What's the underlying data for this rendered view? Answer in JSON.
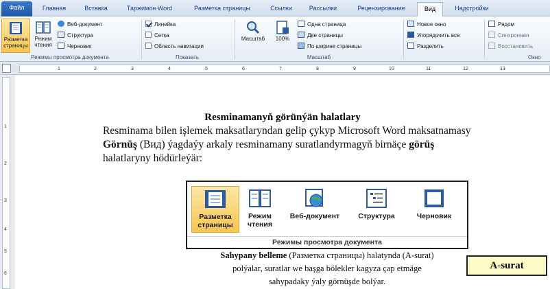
{
  "tabs": [
    "Файл",
    "Главная",
    "Вставка",
    "Таржимон Word",
    "Разметка страницы",
    "Ссылки",
    "Рассылки",
    "Рецензирование",
    "Вид",
    "Надстройки"
  ],
  "active_tab": "Вид",
  "ribbon": {
    "views_group": {
      "print_layout": "Разметка страницы",
      "full_reading": "Режим чтения",
      "web_layout": "Веб-документ",
      "outline": "Структура",
      "draft": "Черновик",
      "label": "Режимы просмотра документа"
    },
    "show_group": {
      "ruler": "Линейка",
      "ruler_checked": true,
      "gridlines": "Сетка",
      "gridlines_checked": false,
      "navigation": "Область навигации",
      "navigation_checked": false,
      "label": "Показать"
    },
    "zoom_group": {
      "zoom": "Масштаб",
      "hundred": "100%",
      "one_page": "Одна страница",
      "two_pages": "Две страницы",
      "page_width": "По ширине страницы",
      "label": "Масштаб"
    },
    "window_group": {
      "new_window": "Новое окно",
      "arrange_all": "Упорядочить все",
      "split": "Разделить",
      "side_by_side": "Рядом",
      "sync_scroll": "Синхронная",
      "reset_pos": "Восстановить",
      "label": "Окно"
    }
  },
  "ruler": {
    "h_ticks": [
      "1",
      "2",
      "3",
      "4",
      "5",
      "6",
      "7",
      "8",
      "9",
      "10",
      "11",
      "12",
      "13"
    ],
    "v_ticks": [
      "1",
      "2",
      "3",
      "4",
      "5",
      "6"
    ]
  },
  "document": {
    "title": "Resminamanyň görünýän halatlary",
    "para_line1": "Resminama bilen işlemek maksatlaryndan gelip çykyp Microsoft Word maksatnamasy",
    "para_line2_b1": "Görnüş",
    "para_line2_mid": " (Вид) ýagdaýy arkaly resminamany suratlandyrmagyň birnäçe ",
    "para_line2_b2": "görüş",
    "para_line3": "halatlaryny hödürleýär:",
    "inset": {
      "b1": "Разметка страницы",
      "b2": "Режим чтения",
      "b3": "Веб-документ",
      "b4": "Структура",
      "b5": "Черновик",
      "label": "Режимы просмотра документа"
    },
    "caption_b": "Sahypany belleme",
    "caption_line1_rest": " (Разметка страницы) halatynda (A-surat)",
    "caption_line2": "polýalar, suratlar we başga bölekler kagyza çap etmäge",
    "caption_line3": "sahypadaky ýaly görnüşde bolýar.",
    "badge": "A-surat"
  }
}
